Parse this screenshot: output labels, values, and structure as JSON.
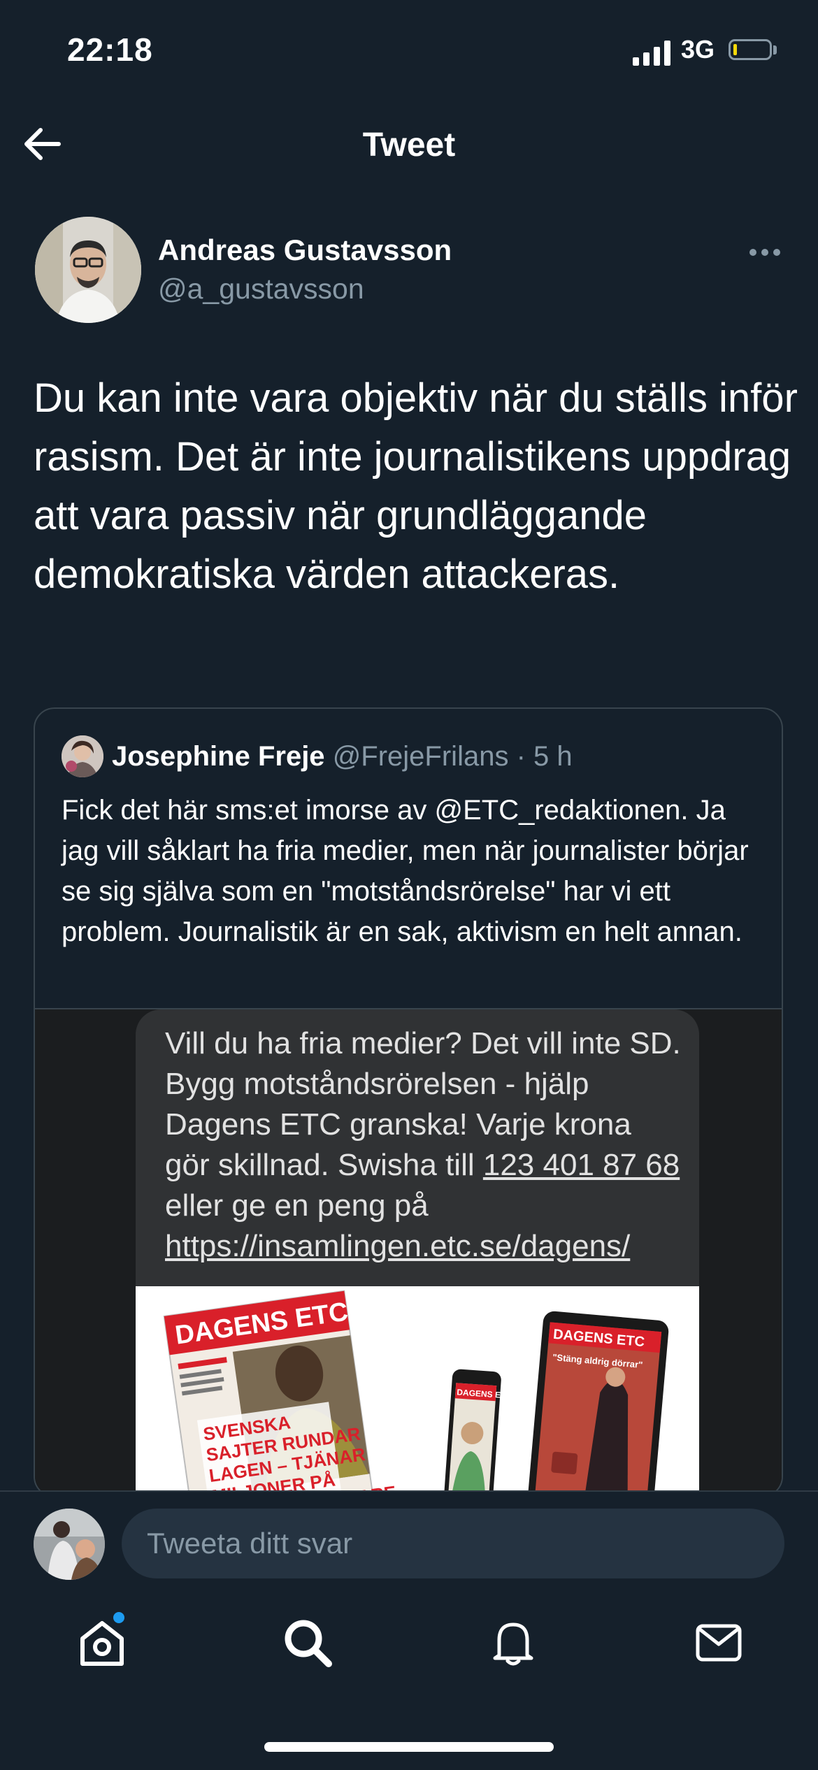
{
  "status_bar": {
    "time": "22:18",
    "network": "3G",
    "icons": [
      "signal-icon",
      "battery-icon"
    ]
  },
  "header": {
    "title": "Tweet",
    "back_icon": "arrow-left-icon"
  },
  "tweet": {
    "author_name": "Andreas Gustavsson",
    "author_handle": "@a_gustavsson",
    "more_icon": "more-horizontal-icon",
    "text": "Du kan inte vara objektiv när du ställs inför rasism. Det är inte journalistikens uppdrag att vara passiv när grundläggande demokratiska värden attackeras."
  },
  "quote": {
    "name": "Josephine Freje",
    "handle": "@FrejeFrilans",
    "time": "· 5 h",
    "text": "Fick det här sms:et imorse av @ETC_redaktionen. Ja jag vill såklart ha fria medier, men när journalister börjar se sig själva som en \"motståndsrörelse\" har vi ett problem. Journalistik är en sak, aktivism en helt annan.",
    "sms": {
      "line1": "Vill du ha fria medier? Det vill inte SD. Bygg motståndsrörelsen - hjälp Dagens ETC granska! Varje krona gör skillnad. Swisha till ",
      "number": "123 401 87 68",
      "line2": " eller ge en peng på ",
      "link": "https://insamlingen.etc.se/dagens/"
    },
    "ad": {
      "logo": "DAGENS ETC",
      "headline": "SVENSKA SAJTER RUNDAR LAGEN – TJÄNAR MILJONER PÅ SPELMISSBRUKARE",
      "phone_logo": "DAGENS ETC",
      "tablet_logo": "DAGENS ETC",
      "tablet_quote": "\"Stäng aldrig dörrar\""
    }
  },
  "reply": {
    "placeholder": "Tweeta ditt svar"
  },
  "tab_bar": {
    "items": [
      "home-icon",
      "search-icon",
      "notifications-icon",
      "messages-icon"
    ]
  },
  "colors": {
    "background": "#15202b",
    "secondary_text": "#8899a6",
    "border": "#38444d",
    "accent": "#1d9bf0"
  }
}
